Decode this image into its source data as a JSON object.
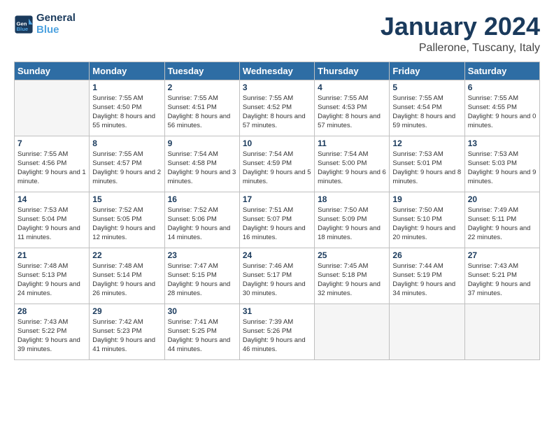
{
  "header": {
    "logo_line1": "General",
    "logo_line2": "Blue",
    "title": "January 2024",
    "subtitle": "Pallerone, Tuscany, Italy"
  },
  "days_of_week": [
    "Sunday",
    "Monday",
    "Tuesday",
    "Wednesday",
    "Thursday",
    "Friday",
    "Saturday"
  ],
  "weeks": [
    [
      {
        "day": "",
        "empty": true
      },
      {
        "day": "1",
        "sunrise": "7:55 AM",
        "sunset": "4:50 PM",
        "daylight": "8 hours and 55 minutes."
      },
      {
        "day": "2",
        "sunrise": "7:55 AM",
        "sunset": "4:51 PM",
        "daylight": "8 hours and 56 minutes."
      },
      {
        "day": "3",
        "sunrise": "7:55 AM",
        "sunset": "4:52 PM",
        "daylight": "8 hours and 57 minutes."
      },
      {
        "day": "4",
        "sunrise": "7:55 AM",
        "sunset": "4:53 PM",
        "daylight": "8 hours and 57 minutes."
      },
      {
        "day": "5",
        "sunrise": "7:55 AM",
        "sunset": "4:54 PM",
        "daylight": "8 hours and 59 minutes."
      },
      {
        "day": "6",
        "sunrise": "7:55 AM",
        "sunset": "4:55 PM",
        "daylight": "9 hours and 0 minutes."
      }
    ],
    [
      {
        "day": "7",
        "sunrise": "7:55 AM",
        "sunset": "4:56 PM",
        "daylight": "9 hours and 1 minute."
      },
      {
        "day": "8",
        "sunrise": "7:55 AM",
        "sunset": "4:57 PM",
        "daylight": "9 hours and 2 minutes."
      },
      {
        "day": "9",
        "sunrise": "7:54 AM",
        "sunset": "4:58 PM",
        "daylight": "9 hours and 3 minutes."
      },
      {
        "day": "10",
        "sunrise": "7:54 AM",
        "sunset": "4:59 PM",
        "daylight": "9 hours and 5 minutes."
      },
      {
        "day": "11",
        "sunrise": "7:54 AM",
        "sunset": "5:00 PM",
        "daylight": "9 hours and 6 minutes."
      },
      {
        "day": "12",
        "sunrise": "7:53 AM",
        "sunset": "5:01 PM",
        "daylight": "9 hours and 8 minutes."
      },
      {
        "day": "13",
        "sunrise": "7:53 AM",
        "sunset": "5:03 PM",
        "daylight": "9 hours and 9 minutes."
      }
    ],
    [
      {
        "day": "14",
        "sunrise": "7:53 AM",
        "sunset": "5:04 PM",
        "daylight": "9 hours and 11 minutes."
      },
      {
        "day": "15",
        "sunrise": "7:52 AM",
        "sunset": "5:05 PM",
        "daylight": "9 hours and 12 minutes."
      },
      {
        "day": "16",
        "sunrise": "7:52 AM",
        "sunset": "5:06 PM",
        "daylight": "9 hours and 14 minutes."
      },
      {
        "day": "17",
        "sunrise": "7:51 AM",
        "sunset": "5:07 PM",
        "daylight": "9 hours and 16 minutes."
      },
      {
        "day": "18",
        "sunrise": "7:50 AM",
        "sunset": "5:09 PM",
        "daylight": "9 hours and 18 minutes."
      },
      {
        "day": "19",
        "sunrise": "7:50 AM",
        "sunset": "5:10 PM",
        "daylight": "9 hours and 20 minutes."
      },
      {
        "day": "20",
        "sunrise": "7:49 AM",
        "sunset": "5:11 PM",
        "daylight": "9 hours and 22 minutes."
      }
    ],
    [
      {
        "day": "21",
        "sunrise": "7:48 AM",
        "sunset": "5:13 PM",
        "daylight": "9 hours and 24 minutes."
      },
      {
        "day": "22",
        "sunrise": "7:48 AM",
        "sunset": "5:14 PM",
        "daylight": "9 hours and 26 minutes."
      },
      {
        "day": "23",
        "sunrise": "7:47 AM",
        "sunset": "5:15 PM",
        "daylight": "9 hours and 28 minutes."
      },
      {
        "day": "24",
        "sunrise": "7:46 AM",
        "sunset": "5:17 PM",
        "daylight": "9 hours and 30 minutes."
      },
      {
        "day": "25",
        "sunrise": "7:45 AM",
        "sunset": "5:18 PM",
        "daylight": "9 hours and 32 minutes."
      },
      {
        "day": "26",
        "sunrise": "7:44 AM",
        "sunset": "5:19 PM",
        "daylight": "9 hours and 34 minutes."
      },
      {
        "day": "27",
        "sunrise": "7:43 AM",
        "sunset": "5:21 PM",
        "daylight": "9 hours and 37 minutes."
      }
    ],
    [
      {
        "day": "28",
        "sunrise": "7:43 AM",
        "sunset": "5:22 PM",
        "daylight": "9 hours and 39 minutes."
      },
      {
        "day": "29",
        "sunrise": "7:42 AM",
        "sunset": "5:23 PM",
        "daylight": "9 hours and 41 minutes."
      },
      {
        "day": "30",
        "sunrise": "7:41 AM",
        "sunset": "5:25 PM",
        "daylight": "9 hours and 44 minutes."
      },
      {
        "day": "31",
        "sunrise": "7:39 AM",
        "sunset": "5:26 PM",
        "daylight": "9 hours and 46 minutes."
      },
      {
        "day": "",
        "empty": true
      },
      {
        "day": "",
        "empty": true
      },
      {
        "day": "",
        "empty": true
      }
    ]
  ]
}
